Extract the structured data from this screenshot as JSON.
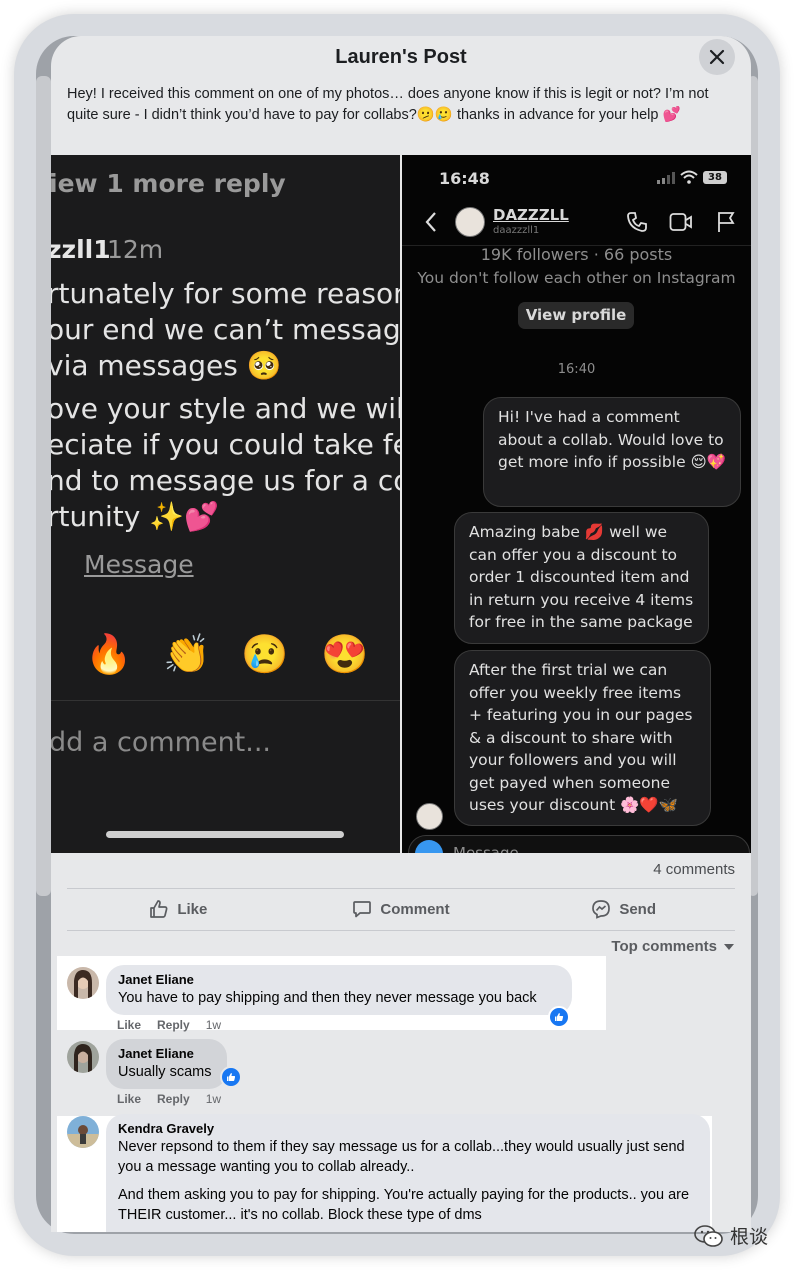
{
  "modal": {
    "title": "Lauren's Post",
    "caption": "Hey! I received this comment on one of my photos… does anyone know if this is legit or not? I’m not quite sure - I didn’t think you’d have to pay for collabs?🫤🥲 thanks in advance for your help 💕"
  },
  "photo_left": {
    "view_more": "iew 1 more reply",
    "username": "zzll1",
    "time": "12m",
    "lines": [
      "rtunately for some reason",
      " our end we can’t message",
      "via messages 🥺",
      "ove your style and we will",
      "eciate if you could take fev",
      "nd to message us for a co",
      "rtunity ✨💕"
    ],
    "message_link": "Message",
    "reactions": [
      "🔥",
      "👏",
      "😢",
      "😍"
    ],
    "add_comment": "dd a comment..."
  },
  "photo_right": {
    "clock": "16:48",
    "battery": "38",
    "username": "DAZZZLL",
    "handle": "daazzzll1",
    "followers": "19K followers · 66 posts",
    "follow_note": "You don't follow each other on Instagram",
    "view_profile": "View profile",
    "timestamp": "16:40",
    "messages": [
      "Hi! I've had a comment about a collab. Would love to get more info if possible 😌💖",
      "Amazing babe 💋 well we can offer you a discount to order 1 discounted item and in return you receive 4 items for free in the same package",
      "After the first trial we can offer you weekly free items + featuring you in our pages & a discount to share with your followers and you will get payed when someone uses your discount 🌸❤️🦋"
    ],
    "composer_placeholder": "Message..."
  },
  "post_stats": {
    "comments_count": "4 comments"
  },
  "actions": {
    "like": "Like",
    "comment": "Comment",
    "send": "Send"
  },
  "sort": {
    "label": "Top comments"
  },
  "comments": [
    {
      "author": "Janet Eliane",
      "text": "You have to pay shipping and then they never message you back",
      "like": "Like",
      "reply": "Reply",
      "time": "1w"
    },
    {
      "author": "Janet Eliane",
      "text": "Usually scams",
      "like": "Like",
      "reply": "Reply",
      "time": "1w"
    },
    {
      "author": "Kendra Gravely",
      "text": "Never repsond to them if they say message us for a collab...they would usually just send you a message wanting you to collab already..",
      "text2": "And them asking you to pay for shipping. You're actually paying for the products.. you are THEIR customer... it's no collab. Block these type of dms"
    }
  ],
  "watermark": {
    "text": "根谈"
  },
  "colors": {
    "facebook_blue": "#1877f2",
    "panel_bg": "#e7e8ea",
    "instagram_bubble": "#1c1c1e"
  }
}
